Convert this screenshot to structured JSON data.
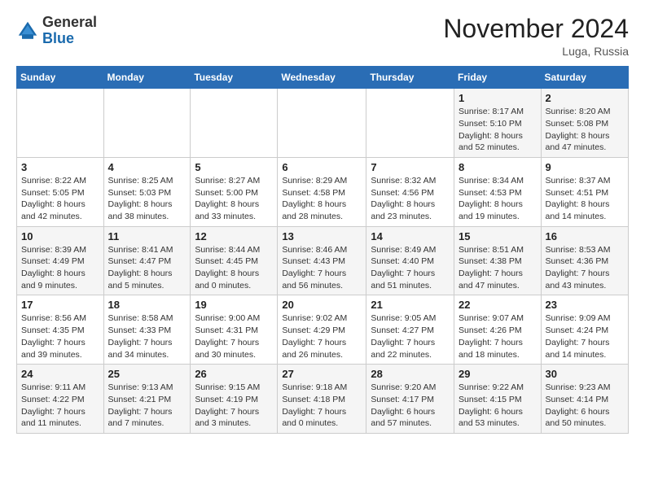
{
  "header": {
    "logo_general": "General",
    "logo_blue": "Blue",
    "month_title": "November 2024",
    "location": "Luga, Russia"
  },
  "days_of_week": [
    "Sunday",
    "Monday",
    "Tuesday",
    "Wednesday",
    "Thursday",
    "Friday",
    "Saturday"
  ],
  "weeks": [
    [
      {
        "day": "",
        "info": ""
      },
      {
        "day": "",
        "info": ""
      },
      {
        "day": "",
        "info": ""
      },
      {
        "day": "",
        "info": ""
      },
      {
        "day": "",
        "info": ""
      },
      {
        "day": "1",
        "info": "Sunrise: 8:17 AM\nSunset: 5:10 PM\nDaylight: 8 hours and 52 minutes."
      },
      {
        "day": "2",
        "info": "Sunrise: 8:20 AM\nSunset: 5:08 PM\nDaylight: 8 hours and 47 minutes."
      }
    ],
    [
      {
        "day": "3",
        "info": "Sunrise: 8:22 AM\nSunset: 5:05 PM\nDaylight: 8 hours and 42 minutes."
      },
      {
        "day": "4",
        "info": "Sunrise: 8:25 AM\nSunset: 5:03 PM\nDaylight: 8 hours and 38 minutes."
      },
      {
        "day": "5",
        "info": "Sunrise: 8:27 AM\nSunset: 5:00 PM\nDaylight: 8 hours and 33 minutes."
      },
      {
        "day": "6",
        "info": "Sunrise: 8:29 AM\nSunset: 4:58 PM\nDaylight: 8 hours and 28 minutes."
      },
      {
        "day": "7",
        "info": "Sunrise: 8:32 AM\nSunset: 4:56 PM\nDaylight: 8 hours and 23 minutes."
      },
      {
        "day": "8",
        "info": "Sunrise: 8:34 AM\nSunset: 4:53 PM\nDaylight: 8 hours and 19 minutes."
      },
      {
        "day": "9",
        "info": "Sunrise: 8:37 AM\nSunset: 4:51 PM\nDaylight: 8 hours and 14 minutes."
      }
    ],
    [
      {
        "day": "10",
        "info": "Sunrise: 8:39 AM\nSunset: 4:49 PM\nDaylight: 8 hours and 9 minutes."
      },
      {
        "day": "11",
        "info": "Sunrise: 8:41 AM\nSunset: 4:47 PM\nDaylight: 8 hours and 5 minutes."
      },
      {
        "day": "12",
        "info": "Sunrise: 8:44 AM\nSunset: 4:45 PM\nDaylight: 8 hours and 0 minutes."
      },
      {
        "day": "13",
        "info": "Sunrise: 8:46 AM\nSunset: 4:43 PM\nDaylight: 7 hours and 56 minutes."
      },
      {
        "day": "14",
        "info": "Sunrise: 8:49 AM\nSunset: 4:40 PM\nDaylight: 7 hours and 51 minutes."
      },
      {
        "day": "15",
        "info": "Sunrise: 8:51 AM\nSunset: 4:38 PM\nDaylight: 7 hours and 47 minutes."
      },
      {
        "day": "16",
        "info": "Sunrise: 8:53 AM\nSunset: 4:36 PM\nDaylight: 7 hours and 43 minutes."
      }
    ],
    [
      {
        "day": "17",
        "info": "Sunrise: 8:56 AM\nSunset: 4:35 PM\nDaylight: 7 hours and 39 minutes."
      },
      {
        "day": "18",
        "info": "Sunrise: 8:58 AM\nSunset: 4:33 PM\nDaylight: 7 hours and 34 minutes."
      },
      {
        "day": "19",
        "info": "Sunrise: 9:00 AM\nSunset: 4:31 PM\nDaylight: 7 hours and 30 minutes."
      },
      {
        "day": "20",
        "info": "Sunrise: 9:02 AM\nSunset: 4:29 PM\nDaylight: 7 hours and 26 minutes."
      },
      {
        "day": "21",
        "info": "Sunrise: 9:05 AM\nSunset: 4:27 PM\nDaylight: 7 hours and 22 minutes."
      },
      {
        "day": "22",
        "info": "Sunrise: 9:07 AM\nSunset: 4:26 PM\nDaylight: 7 hours and 18 minutes."
      },
      {
        "day": "23",
        "info": "Sunrise: 9:09 AM\nSunset: 4:24 PM\nDaylight: 7 hours and 14 minutes."
      }
    ],
    [
      {
        "day": "24",
        "info": "Sunrise: 9:11 AM\nSunset: 4:22 PM\nDaylight: 7 hours and 11 minutes."
      },
      {
        "day": "25",
        "info": "Sunrise: 9:13 AM\nSunset: 4:21 PM\nDaylight: 7 hours and 7 minutes."
      },
      {
        "day": "26",
        "info": "Sunrise: 9:15 AM\nSunset: 4:19 PM\nDaylight: 7 hours and 3 minutes."
      },
      {
        "day": "27",
        "info": "Sunrise: 9:18 AM\nSunset: 4:18 PM\nDaylight: 7 hours and 0 minutes."
      },
      {
        "day": "28",
        "info": "Sunrise: 9:20 AM\nSunset: 4:17 PM\nDaylight: 6 hours and 57 minutes."
      },
      {
        "day": "29",
        "info": "Sunrise: 9:22 AM\nSunset: 4:15 PM\nDaylight: 6 hours and 53 minutes."
      },
      {
        "day": "30",
        "info": "Sunrise: 9:23 AM\nSunset: 4:14 PM\nDaylight: 6 hours and 50 minutes."
      }
    ]
  ]
}
